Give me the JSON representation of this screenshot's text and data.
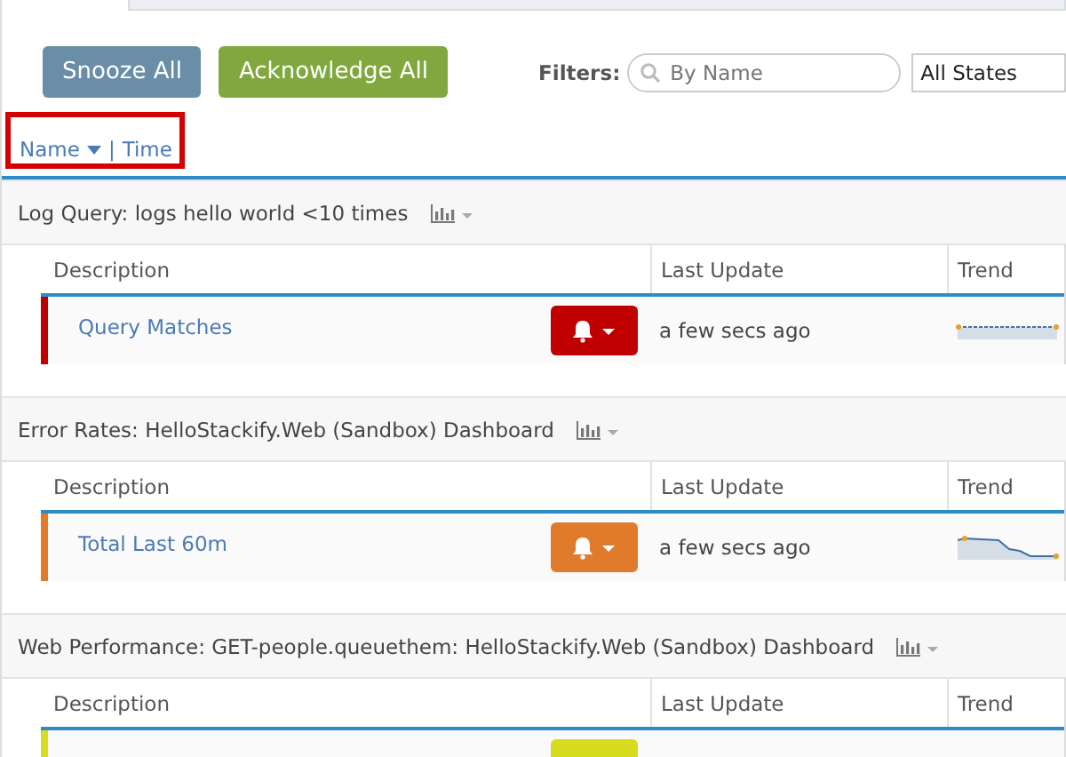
{
  "toolbar": {
    "buttons": [
      {
        "label": "Snooze All",
        "kind": "snooze"
      },
      {
        "label": "Acknowledge All",
        "kind": "acknowledge"
      }
    ],
    "filters_label": "Filters:",
    "search": {
      "placeholder": "By Name"
    },
    "state_select": {
      "value": "All States"
    }
  },
  "sort": {
    "name": "Name",
    "separator": "|",
    "time": "Time"
  },
  "groups": [
    {
      "title": "Log Query: logs hello world <10 times",
      "columns": [
        "Description",
        "Last Update",
        "Trend"
      ],
      "rows": [
        {
          "name": "Query Matches",
          "color": "#c00000",
          "updated": "a few secs ago",
          "kind": "flat"
        }
      ]
    },
    {
      "title": "Error Rates: HelloStackify.Web (Sandbox) Dashboard",
      "columns": [
        "Description",
        "Last Update",
        "Trend"
      ],
      "rows": [
        {
          "name": "Total Last 60m",
          "color": "#e07b2b",
          "updated": "a few secs ago",
          "kind": "drop"
        }
      ]
    },
    {
      "title": "Web Performance: GET-people.queuethem: HelloStackify.Web (Sandbox) Dashboard",
      "columns": [
        "Description",
        "Last Update",
        "Trend"
      ],
      "rows": [
        {
          "color": "#d8dc1e",
          "kind": "cut"
        }
      ]
    }
  ]
}
